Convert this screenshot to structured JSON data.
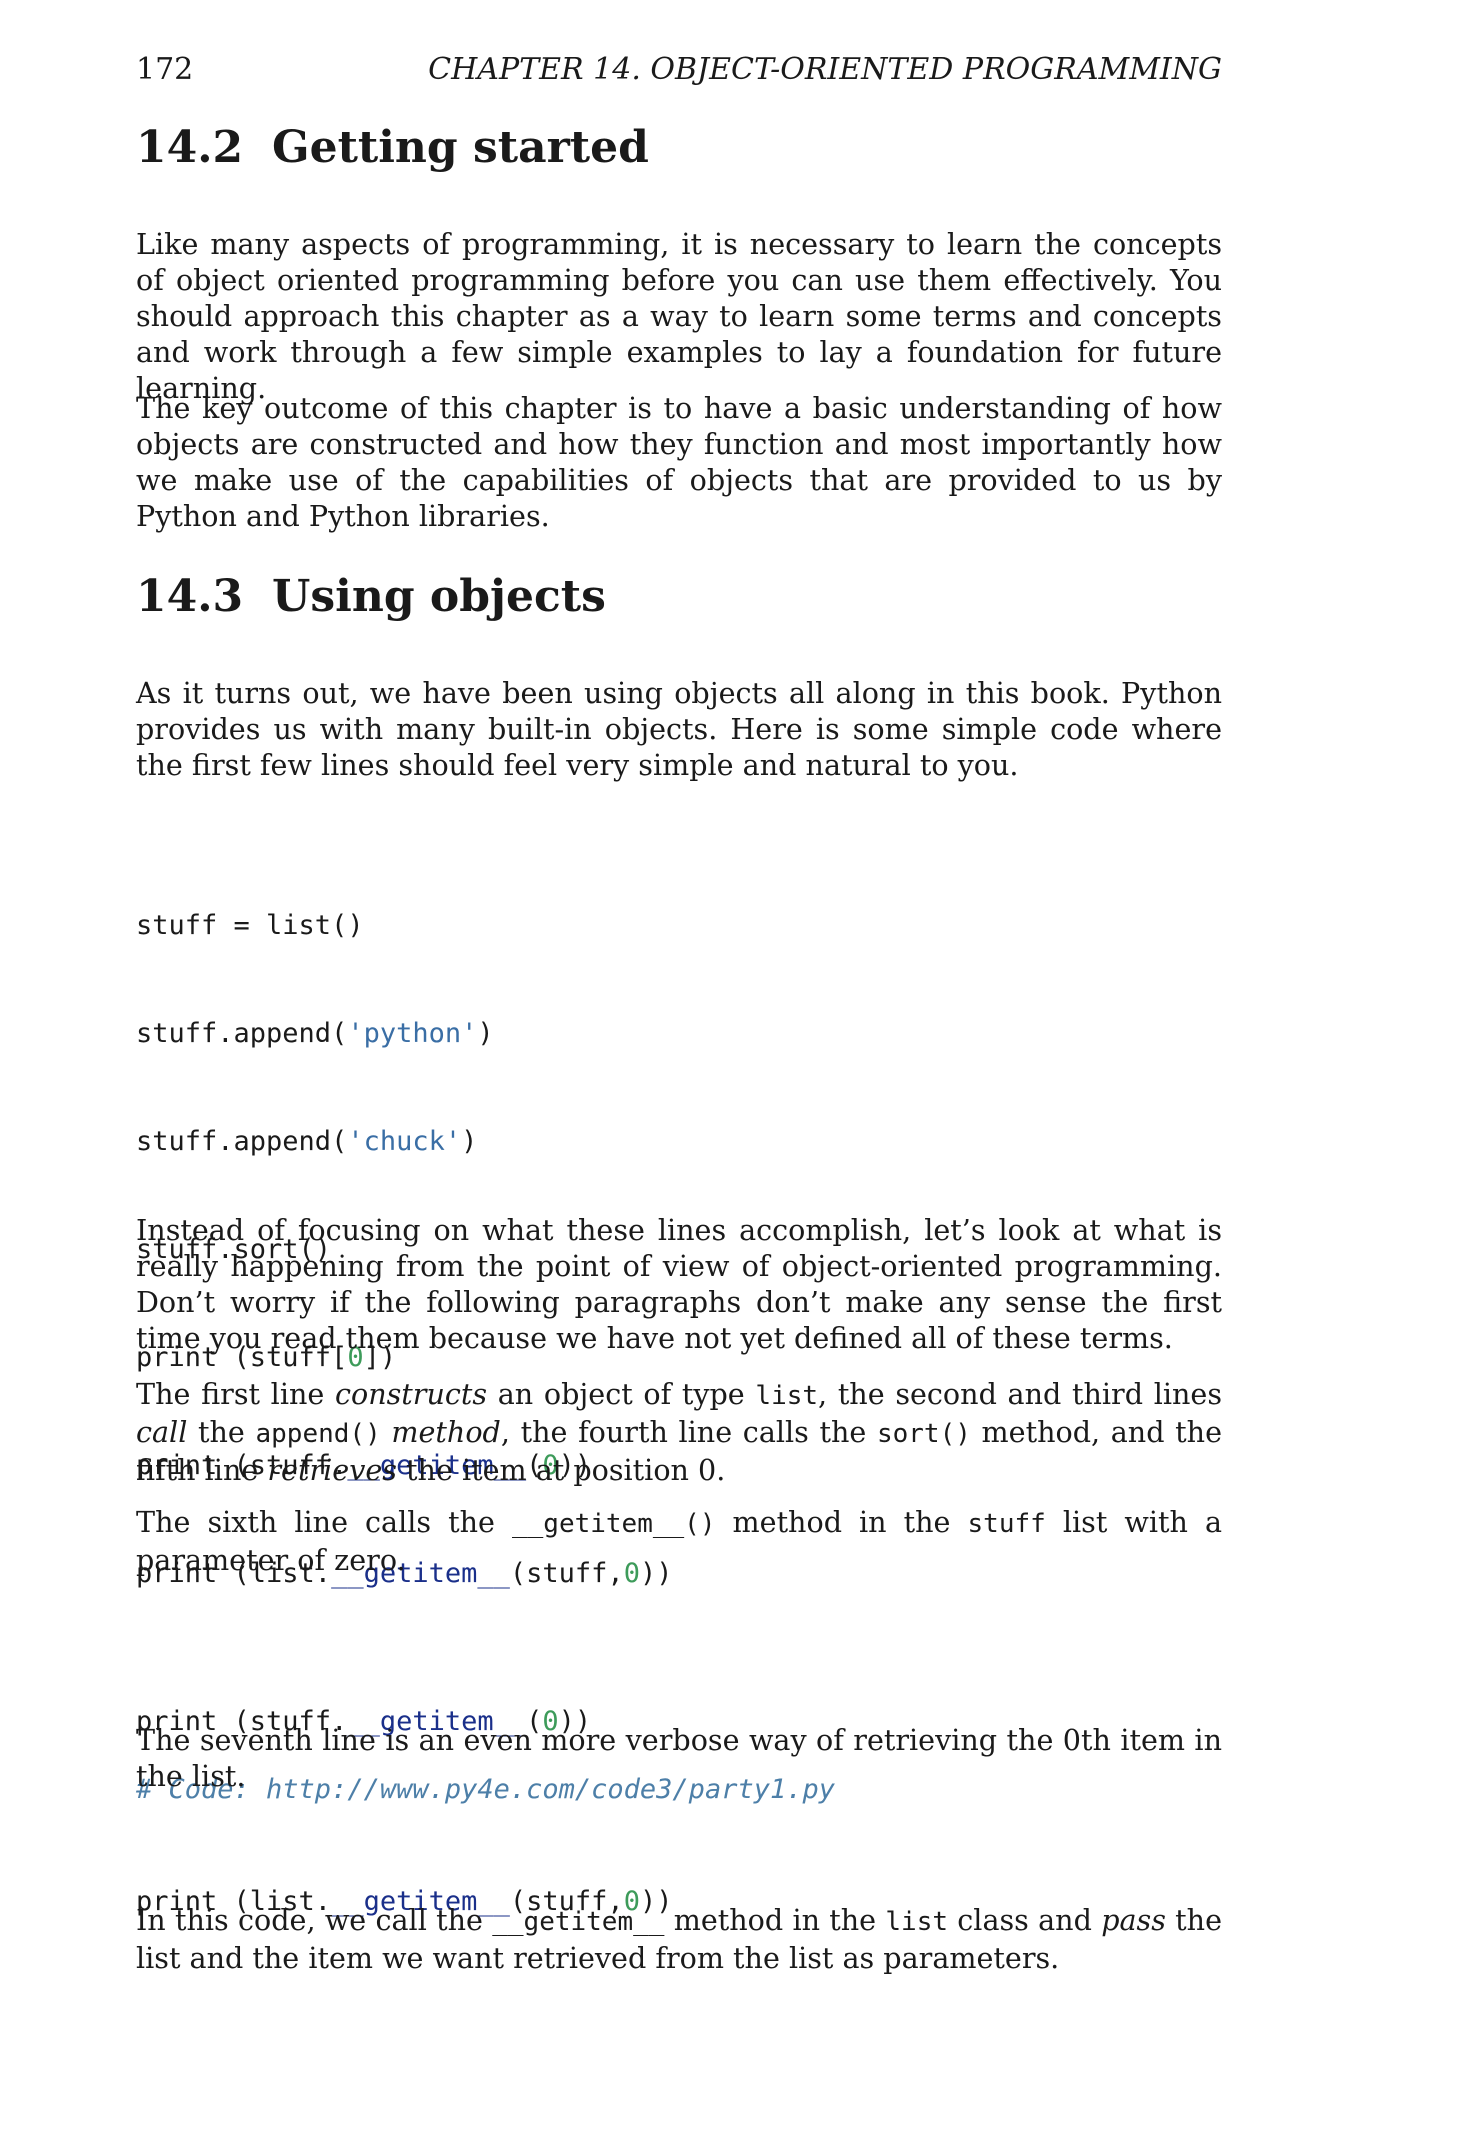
{
  "header": {
    "page_number": "172",
    "chapter_title": "CHAPTER 14.  OBJECT-ORIENTED PROGRAMMING"
  },
  "section_14_2": {
    "number": "14.2",
    "title": "Getting started",
    "p1": "Like many aspects of programming, it is necessary to learn the concepts of object oriented programming before you can use them effectively. You should approach this chapter as a way to learn some terms and concepts and work through a few simple examples to lay a foundation for future learning.",
    "p2": "The key outcome of this chapter is to have a basic understanding of how objects are constructed and how they function and most importantly how we make use of the capabilities of objects that are provided to us by Python and Python libraries."
  },
  "section_14_3": {
    "number": "14.3",
    "title": "Using objects",
    "p1": "As it turns out, we have been using objects all along in this book. Python provides us with many built-in objects. Here is some simple code where the first few lines should feel very simple and natural to you.",
    "code1": {
      "l1": "stuff = list()",
      "l2_a": "stuff.append(",
      "l2_s": "'python'",
      "l2_b": ")",
      "l3_a": "stuff.append(",
      "l3_s": "'chuck'",
      "l3_b": ")",
      "l4": "stuff.sort()",
      "l5_a": "print (stuff[",
      "l5_n": "0",
      "l5_b": "])",
      "l6_a": "print (stuff.",
      "l6_d": "__getitem__",
      "l6_b": "(",
      "l6_n": "0",
      "l6_c": "))",
      "l7_a": "print (list.",
      "l7_d": "__getitem__",
      "l7_b": "(stuff,",
      "l7_n": "0",
      "l7_c": "))",
      "comment": "# Code: http://www.py4e.com/code3/party1.py"
    },
    "p2": "Instead of focusing on what these lines accomplish, let’s look at what is really happening from the point of view of object-oriented programming. Don’t worry if the following paragraphs don’t make any sense the first time you read them because we have not yet defined all of these terms.",
    "p3": {
      "t1": "The first line ",
      "e1": "constructs",
      "t2": " an object of type ",
      "c1": "list",
      "t3": ", the second and third lines ",
      "e2": "call",
      "t4": " the ",
      "c2": "append()",
      "t5": " ",
      "e3": "method",
      "t6": ", the fourth line calls the ",
      "c3": "sort()",
      "t7": " method, and the fifth line ",
      "e4": "retrieves",
      "t8": " the item at position 0."
    },
    "p4": {
      "t1": "The sixth line calls the ",
      "c1": "__getitem__()",
      "t2": " method in the ",
      "c2": "stuff",
      "t3": " list with a parameter of zero."
    },
    "code2": {
      "a": "print (stuff.",
      "d": "__getitem__",
      "b": "(",
      "n": "0",
      "c": "))"
    },
    "p5": "The seventh line is an even more verbose way of retrieving the 0th item in the list.",
    "code3": {
      "a": "print (list.",
      "d": "__getitem__",
      "b": "(stuff,",
      "n": "0",
      "c": "))"
    },
    "p6": {
      "t1": "In this code, we call the ",
      "c1": "__getitem__",
      "t2": " method in the ",
      "c2": "list",
      "t3": " class and ",
      "e1": "pass",
      "t4": " the list and the item we want retrieved from the list as parameters."
    }
  }
}
